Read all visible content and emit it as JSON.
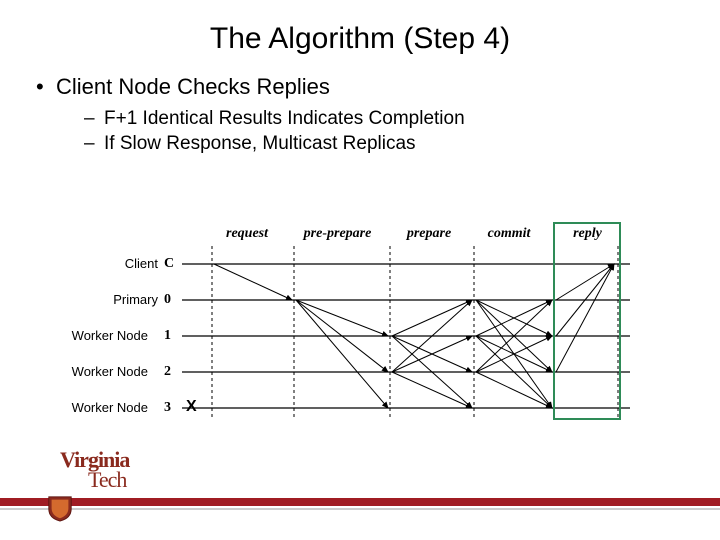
{
  "title": "The Algorithm (Step 4)",
  "bullets": {
    "l1": "Client Node Checks Replies",
    "l2a": "F+1 Identical Results Indicates Completion",
    "l2b": "If Slow Response, Multicast Replicas"
  },
  "diagram": {
    "phases": [
      "request",
      "pre-prepare",
      "prepare",
      "commit",
      "reply"
    ],
    "nodes": [
      {
        "label": "Client",
        "id": "C"
      },
      {
        "label": "Primary",
        "id": "0"
      },
      {
        "label": "Worker Node",
        "id": "1"
      },
      {
        "label": "Worker Node",
        "id": "2"
      },
      {
        "label": "Worker Node",
        "id": "3"
      }
    ],
    "x_mark": "X"
  },
  "logo": {
    "line1": "Virginia",
    "line2": "Tech"
  }
}
